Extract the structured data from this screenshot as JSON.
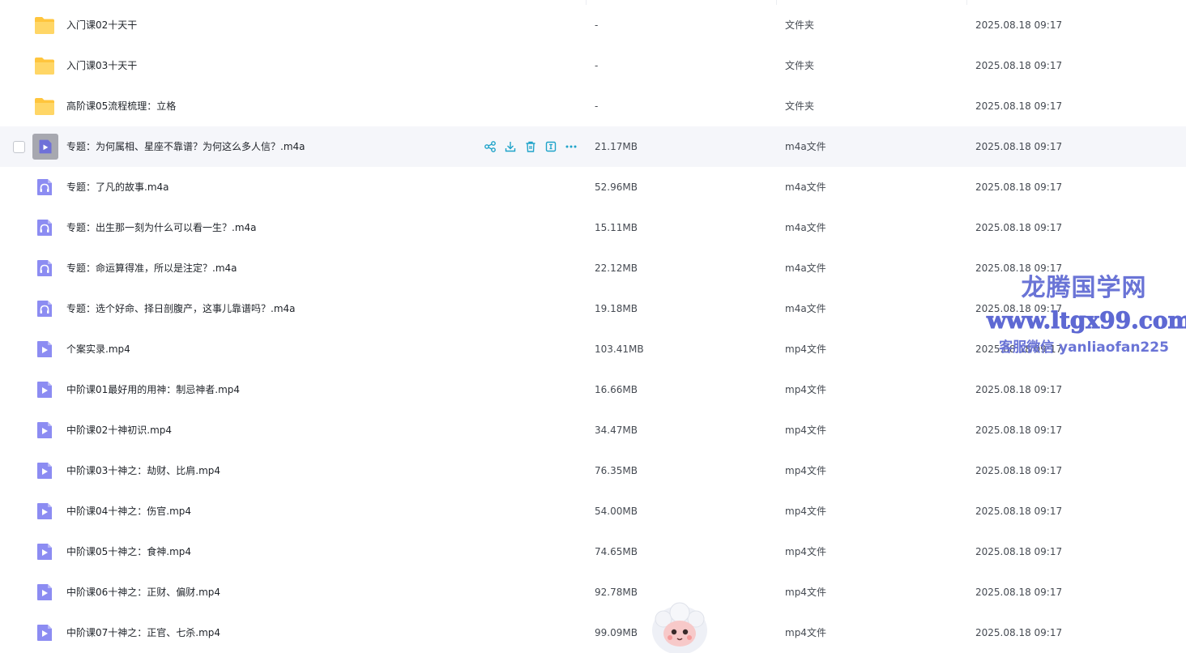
{
  "files": [
    {
      "name": "入门课02十天干",
      "size": "-",
      "type": "文件夹",
      "date": "2025.08.18 09:17",
      "icon": "folder"
    },
    {
      "name": "入门课03十天干",
      "size": "-",
      "type": "文件夹",
      "date": "2025.08.18 09:17",
      "icon": "folder"
    },
    {
      "name": "高阶课05流程梳理：立格",
      "size": "-",
      "type": "文件夹",
      "date": "2025.08.18 09:17",
      "icon": "folder"
    },
    {
      "name": "专题：为何属相、星座不靠谱？为何这么多人信？.m4a",
      "size": "21.17MB",
      "type": "m4a文件",
      "date": "2025.08.18 09:17",
      "icon": "audio"
    },
    {
      "name": "专题：了凡的故事.m4a",
      "size": "52.96MB",
      "type": "m4a文件",
      "date": "2025.08.18 09:17",
      "icon": "audio"
    },
    {
      "name": "专题：出生那一刻为什么可以看一生？.m4a",
      "size": "15.11MB",
      "type": "m4a文件",
      "date": "2025.08.18 09:17",
      "icon": "audio"
    },
    {
      "name": "专题：命运算得准，所以是注定？.m4a",
      "size": "22.12MB",
      "type": "m4a文件",
      "date": "2025.08.18 09:17",
      "icon": "audio"
    },
    {
      "name": "专题：选个好命、择日剖腹产，这事儿靠谱吗？.m4a",
      "size": "19.18MB",
      "type": "m4a文件",
      "date": "2025.08.18 09:17",
      "icon": "audio"
    },
    {
      "name": "个案实录.mp4",
      "size": "103.41MB",
      "type": "mp4文件",
      "date": "2025.08.18 09:17",
      "icon": "video"
    },
    {
      "name": "中阶课01最好用的用神：制忌神者.mp4",
      "size": "16.66MB",
      "type": "mp4文件",
      "date": "2025.08.18 09:17",
      "icon": "video"
    },
    {
      "name": "中阶课02十神初识.mp4",
      "size": "34.47MB",
      "type": "mp4文件",
      "date": "2025.08.18 09:17",
      "icon": "video"
    },
    {
      "name": "中阶课03十神之：劫财、比肩.mp4",
      "size": "76.35MB",
      "type": "mp4文件",
      "date": "2025.08.18 09:17",
      "icon": "video"
    },
    {
      "name": "中阶课04十神之：伤官.mp4",
      "size": "54.00MB",
      "type": "mp4文件",
      "date": "2025.08.18 09:17",
      "icon": "video"
    },
    {
      "name": "中阶课05十神之：食神.mp4",
      "size": "74.65MB",
      "type": "mp4文件",
      "date": "2025.08.18 09:17",
      "icon": "video"
    },
    {
      "name": "中阶课06十神之：正财、偏财.mp4",
      "size": "92.78MB",
      "type": "mp4文件",
      "date": "2025.08.18 09:17",
      "icon": "video"
    },
    {
      "name": "中阶课07十神之：正官、七杀.mp4",
      "size": "99.09MB",
      "type": "mp4文件",
      "date": "2025.08.18 09:17",
      "icon": "video"
    }
  ],
  "hovered_row_index": 3,
  "hover_actions": [
    "share-icon",
    "download-icon",
    "delete-icon",
    "rename-icon",
    "more-icon"
  ],
  "watermark": {
    "line1": "龙腾国学网",
    "line2": "www.ltgx99.com",
    "line3": "客服微信 yanliaofan225"
  },
  "colors": {
    "accent": "#1fa3c9",
    "folder": "#ffcc33",
    "media_icon": "#8c8cf2",
    "hover_row": "#f5f6fa",
    "watermark": "#6a74d6"
  }
}
